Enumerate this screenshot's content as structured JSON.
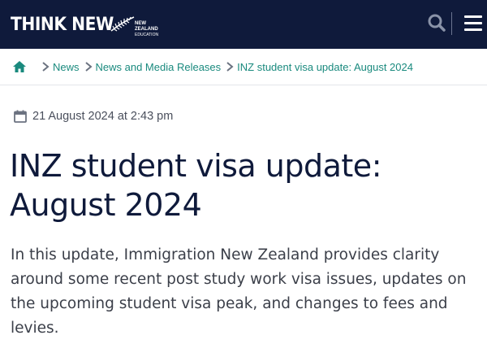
{
  "header": {
    "logo_text": "THINK NEW",
    "logo_sub_line1": "NEW ZEALAND",
    "logo_sub_line2": "EDUCATION",
    "search_icon": "search-icon",
    "menu_icon": "hamburger-menu-icon",
    "background_color": "#0f1a3b"
  },
  "breadcrumb": {
    "home_icon": "home-icon",
    "items": [
      {
        "label": "News"
      },
      {
        "label": "News and Media Releases"
      },
      {
        "label": "INZ student visa update: August 2024"
      }
    ],
    "link_color": "#1a8a7e"
  },
  "article": {
    "date_icon": "calendar-icon",
    "date": "21 August 2024 at 2:43 pm",
    "title_line1": "INZ student visa update:",
    "title_line2": "August 2024",
    "summary": "In this update, Immigration New Zealand provides clarity around some recent post study work visa issues, updates on the upcoming student visa peak, and changes to fees and levies."
  }
}
